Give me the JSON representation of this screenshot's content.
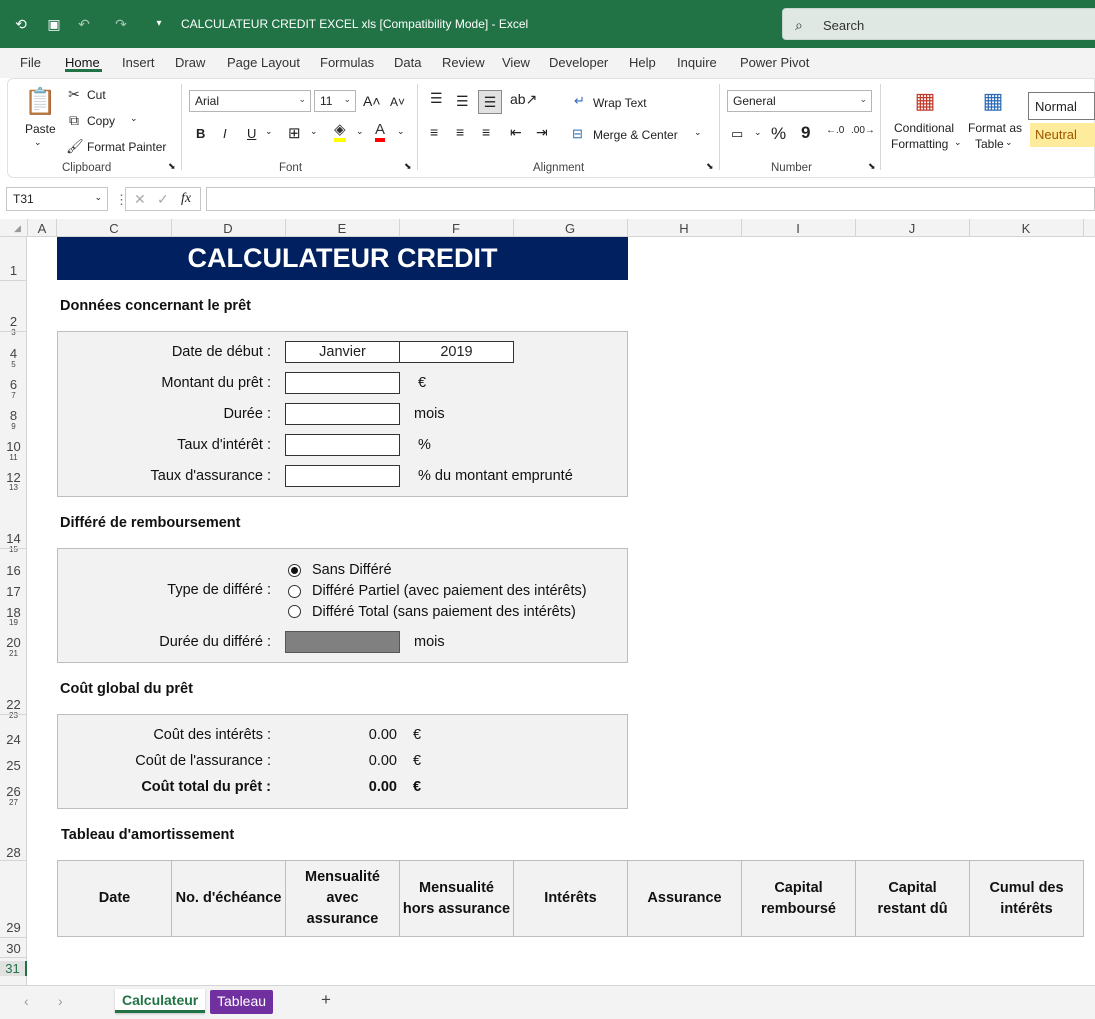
{
  "titlebar": {
    "title": "CALCULATEUR CREDIT EXCEL xls  [Compatibility Mode]  -  Excel",
    "search_placeholder": "Search"
  },
  "menu": [
    "File",
    "Home",
    "Insert",
    "Draw",
    "Page Layout",
    "Formulas",
    "Data",
    "Review",
    "View",
    "Developer",
    "Help",
    "Inquire",
    "Power Pivot"
  ],
  "ribbon": {
    "clipboard": {
      "paste": "Paste",
      "cut": "Cut",
      "copy": "Copy",
      "format_painter": "Format Painter",
      "group": "Clipboard"
    },
    "font": {
      "name": "Arial",
      "size": "11",
      "group": "Font",
      "bold": "B",
      "italic": "I",
      "underline": "U"
    },
    "alignment": {
      "wrap": "Wrap Text",
      "merge": "Merge & Center",
      "group": "Alignment"
    },
    "number": {
      "format": "General",
      "percent": "%",
      "comma": "9",
      "group": "Number"
    },
    "styles": {
      "cond1": "Conditional",
      "cond2": "Formatting",
      "table1": "Format as",
      "table2": "Table",
      "normal": "Normal",
      "neutral": "Neutral"
    }
  },
  "namebox": "T31",
  "fx_label": "fx",
  "columns": [
    "A",
    "C",
    "D",
    "E",
    "F",
    "G",
    "H",
    "I",
    "J",
    "K"
  ],
  "rows": [
    "1",
    "2",
    "3",
    "4",
    "5",
    "6",
    "7",
    "8",
    "9",
    "10",
    "11",
    "12",
    "13",
    "14",
    "15",
    "16",
    "17",
    "18",
    "19",
    "20",
    "21",
    "22",
    "23",
    "24",
    "25",
    "26",
    "27",
    "28",
    "29",
    "30",
    "31"
  ],
  "sheet": {
    "title": "CALCULATEUR CREDIT",
    "loan_section": "Données concernant le prêt",
    "start_date_label": "Date de début :",
    "start_month": "Janvier",
    "start_year": "2019",
    "amount_label": "Montant du prêt :",
    "amount_unit": "€",
    "duration_label": "Durée :",
    "duration_unit": "mois",
    "rate_label": "Taux d'intérêt :",
    "rate_unit": "%",
    "insurance_label": "Taux d'assurance :",
    "insurance_unit": "% du montant emprunté",
    "deferral_section": "Différé de remboursement",
    "deferral_type_label": "Type de différé :",
    "deferral_options": [
      "Sans Différé",
      "Différé Partiel (avec paiement des intérêts)",
      "Différé Total (sans paiement des intérêts)"
    ],
    "deferral_duration_label": "Durée du différé :",
    "deferral_duration_unit": "mois",
    "cost_section": "Coût global du prêt",
    "interest_cost_label": "Coût des intérêts :",
    "interest_cost": "0.00",
    "interest_cost_unit": "€",
    "insurance_cost_label": "Coût de l'assurance :",
    "insurance_cost": "0.00",
    "insurance_cost_unit": "€",
    "total_cost_label": "Coût total du prêt :",
    "total_cost": "0.00",
    "total_cost_unit": "€",
    "table_section": "Tableau d'amortissement",
    "table_headers": [
      "Date",
      "No. d'échéance",
      "Mensualité avec assurance",
      "Mensualité hors assurance",
      "Intérêts",
      "Assurance",
      "Capital remboursé",
      "Capital restant dû",
      "Cumul des intérêts"
    ]
  },
  "sheet_tabs": [
    "Calculateur",
    "Tableau"
  ],
  "add_sheet": "+"
}
